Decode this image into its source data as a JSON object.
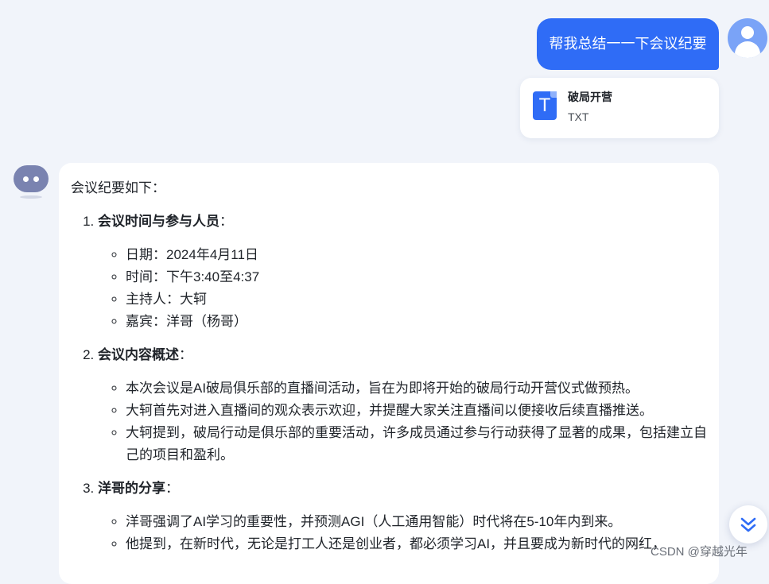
{
  "user_message": {
    "text": "帮我总结一一下会议纪要",
    "attachment": {
      "name": "破局开营",
      "type": "TXT",
      "icon": "txt-file-icon",
      "icon_letter": "T"
    }
  },
  "bot_message": {
    "intro": "会议纪要如下：",
    "sections": [
      {
        "title": "会议时间与参与人员",
        "title_suffix": "：",
        "items": [
          "日期：2024年4月11日",
          "时间：下午3:40至4:37",
          "主持人：大轲",
          "嘉宾：洋哥（杨哥）"
        ]
      },
      {
        "title": "会议内容概述",
        "title_suffix": "：",
        "items": [
          "本次会议是AI破局俱乐部的直播间活动，旨在为即将开始的破局行动开营仪式做预热。",
          "大轲首先对进入直播间的观众表示欢迎，并提醒大家关注直播间以便接收后续直播推送。",
          "大轲提到，破局行动是俱乐部的重要活动，许多成员通过参与行动获得了显著的成果，包括建立自己的项目和盈利。"
        ]
      },
      {
        "title": "洋哥的分享",
        "title_suffix": "：",
        "items": [
          "洋哥强调了AI学习的重要性，并预测AGI（人工通用智能）时代将在5-10年内到来。",
          "他提到，在新时代，无论是打工人还是创业者，都必须学习AI，并且要成为新时代的网红，"
        ]
      }
    ]
  },
  "watermark": "CSDN @穿越光年",
  "colors": {
    "accent": "#2f6cf6",
    "background": "#f1f4fa",
    "card": "#ffffff"
  }
}
